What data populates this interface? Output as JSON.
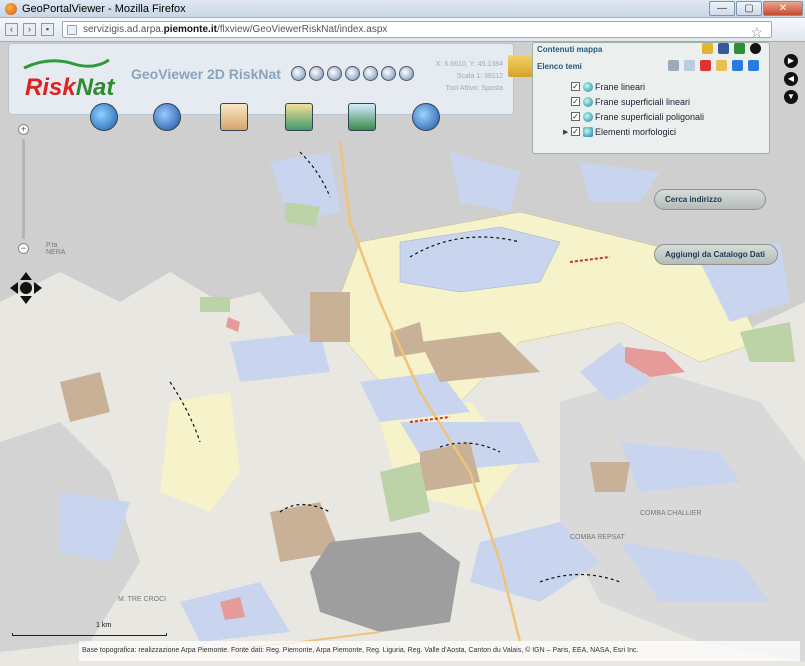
{
  "browser": {
    "title": "GeoPortalViewer - Mozilla Firefox",
    "url_prefix": "servizigis.ad.arpa.",
    "url_domain": "piemonte.it",
    "url_path": "/flxview/GeoViewerRiskNat/index.aspx",
    "window_buttons": [
      "—",
      "▢",
      "✕"
    ],
    "nav_icons": [
      "back-icon",
      "forward-icon",
      "lock-icon"
    ],
    "star_glyph": "☆"
  },
  "app": {
    "logo": {
      "prefix": "Risk",
      "suffix": "Nat"
    },
    "title": "GeoViewer 2D RiskNat",
    "coords": "X: 6.6610, Y: 45.1384",
    "scale": "Scala 1: 38112",
    "active_tool": "Tool Attivo: Sposta",
    "toolbar_icons": [
      "zoom-in-icon",
      "zoom-out-icon",
      "pan-hand-icon",
      "full-extent-icon",
      "info-icon",
      "measure-icon",
      "refresh-icon"
    ],
    "main_buttons": [
      "globe-icon",
      "compass-icon",
      "map-markers-icon",
      "layers-icon",
      "add-layer-icon",
      "help-icon"
    ]
  },
  "layers_panel": {
    "title": "Contenuti mappa",
    "subtitle": "Elenco temi",
    "items": [
      {
        "label": "Frane lineari",
        "checked": true,
        "expanded": false
      },
      {
        "label": "Frane superficiali lineari",
        "checked": true,
        "expanded": false
      },
      {
        "label": "Frane superficiali poligonali",
        "checked": true,
        "expanded": false
      },
      {
        "label": "Elementi morfologici",
        "checked": true,
        "expanded": false
      }
    ],
    "header_icons": [
      "open-folder-icon",
      "tools-icon",
      "export-icon",
      "close-circle-icon"
    ],
    "toolbar_icons": [
      "list-icon",
      "table-icon",
      "delete-x-icon",
      "search-icon",
      "arrow-up-icon",
      "arrow-down-icon"
    ]
  },
  "side_buttons": [
    "arrow-right-circle-icon",
    "arrow-left-circle-icon",
    "arrow-down-circle-icon"
  ],
  "buttons": {
    "search_address": "Cerca indirizzo",
    "add_catalog": "Aggiungi da Catalogo Dati"
  },
  "map_labels": {
    "top_left": "P.ta\nNERA",
    "bottom_left": "M. TRE CROCI",
    "combe1": "COMBA CHALLIER",
    "combe2": "COMBA REPSAT"
  },
  "scale_bar": "1 km",
  "attribution": "Base topografica: realizzazione Arpa Piemonte. Fonte dati: Reg. Piemonte, Arpa Piemonte, Reg. Liguria, Reg. Valle d'Aosta, Canton du Valais, © IGN – Paris, EEA, NASA, Esri Inc.",
  "colors": {
    "landslide_blue": "#c9d4ee",
    "deposit_yellow": "#f6f2c9",
    "debris_tan": "#c8b197",
    "veg_green": "#bcd3a8",
    "active_red": "#e79a9a",
    "relief_gray": "#c6c6c6"
  }
}
